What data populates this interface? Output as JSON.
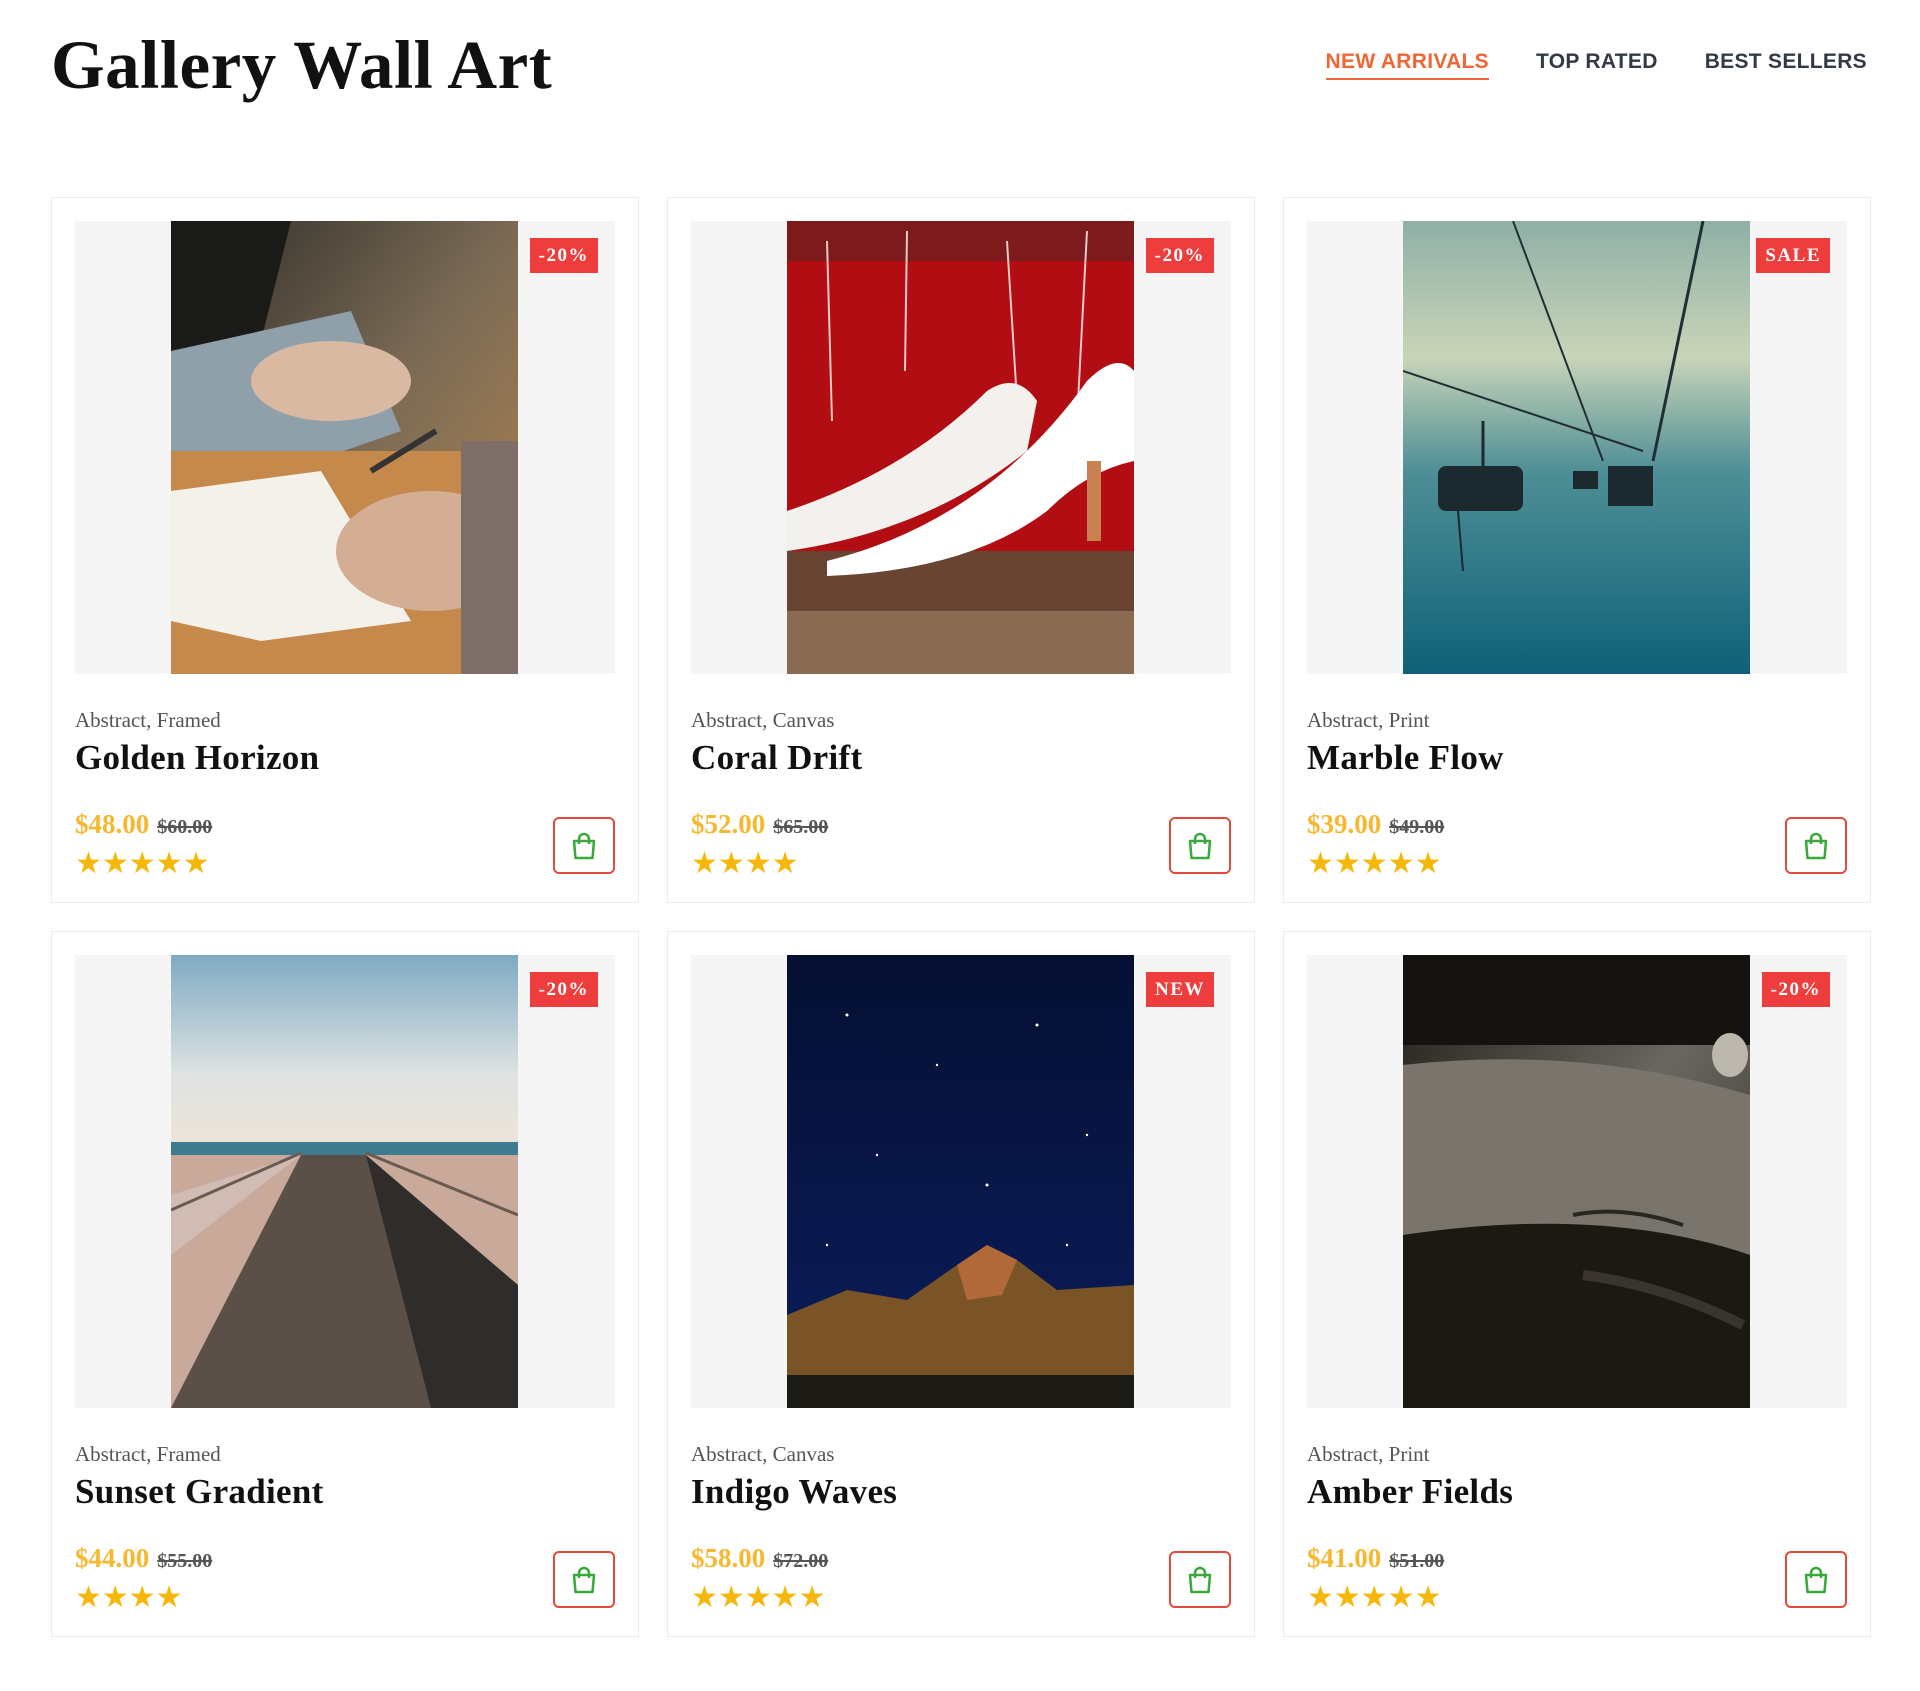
{
  "header": {
    "title": "Gallery Wall Art",
    "tabs": [
      {
        "label": "NEW ARRIVALS",
        "active": true
      },
      {
        "label": "TOP RATED",
        "active": false
      },
      {
        "label": "BEST SELLERS",
        "active": false
      }
    ]
  },
  "colors": {
    "accent": "#ee6633",
    "badge": "#ee3d3d",
    "price": "#f5b82e",
    "stars": "#f5b80a",
    "cart_icon": "#3aa83a",
    "cart_border": "#e24a3a"
  },
  "products": [
    {
      "badge": "-20%",
      "category": "Abstract, Framed",
      "name": "Golden Horizon",
      "price": "$48.00",
      "old_price": "$60.00",
      "stars": "★★★★★",
      "rating": 5,
      "image": "hands-writing-notebook",
      "cart_icon": "shopping-bag-icon"
    },
    {
      "badge": "-20%",
      "category": "Abstract, Canvas",
      "name": "Coral Drift",
      "price": "$52.00",
      "old_price": "$65.00",
      "stars": "★★★★",
      "rating": 4,
      "image": "white-heels-red-wall",
      "cart_icon": "shopping-bag-icon"
    },
    {
      "badge": "SALE",
      "category": "Abstract, Print",
      "name": "Marble Flow",
      "price": "$39.00",
      "old_price": "$49.00",
      "stars": "★★★★★",
      "rating": 5,
      "image": "ski-lift-fog",
      "cart_icon": "shopping-bag-icon"
    },
    {
      "badge": "-20%",
      "category": "Abstract, Framed",
      "name": "Sunset Gradient",
      "price": "$44.00",
      "old_price": "$55.00",
      "stars": "★★★★",
      "rating": 4,
      "image": "boardwalk-sea",
      "cart_icon": "shopping-bag-icon"
    },
    {
      "badge": "NEW",
      "category": "Abstract, Canvas",
      "name": "Indigo Waves",
      "price": "$58.00",
      "old_price": "$72.00",
      "stars": "★★★★★",
      "rating": 5,
      "image": "night-sky-mountain",
      "cart_icon": "shopping-bag-icon"
    },
    {
      "badge": "-20%",
      "category": "Abstract, Print",
      "name": "Amber Fields",
      "price": "$41.00",
      "old_price": "$51.00",
      "stars": "★★★★★",
      "rating": 5,
      "image": "vintage-car-hood",
      "cart_icon": "shopping-bag-icon"
    }
  ]
}
